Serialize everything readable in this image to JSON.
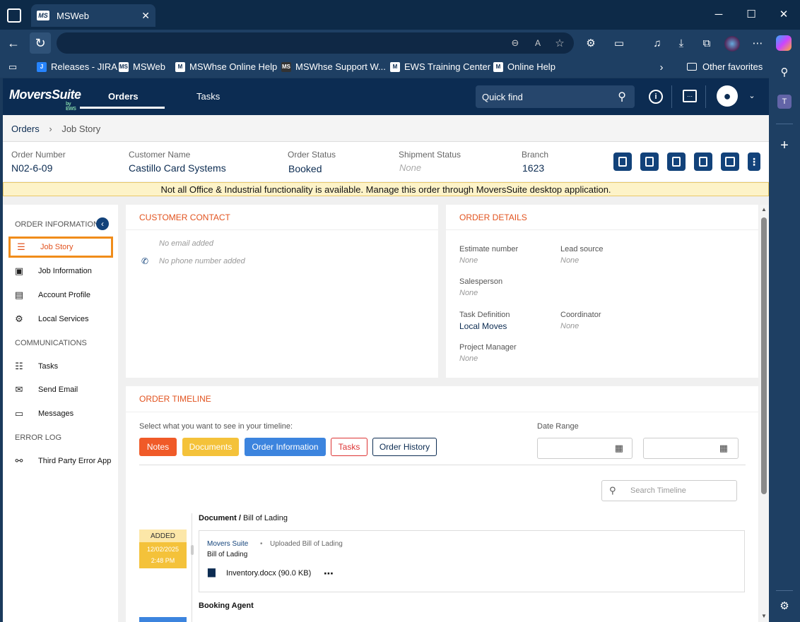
{
  "browser": {
    "tab_title": "MSWeb",
    "tab_favicon": "MS",
    "bookmarks": [
      {
        "label": "Releases - JIRA",
        "icon": "jira-icon"
      },
      {
        "label": "MSWeb",
        "icon": "MS"
      },
      {
        "label": "MSWhse Online Help",
        "icon": "M"
      },
      {
        "label": "MSWhse Support W...",
        "icon": "MS"
      },
      {
        "label": "EWS Training Center",
        "icon": "M"
      },
      {
        "label": "Online Help",
        "icon": "M"
      }
    ],
    "other_favorites": "Other favorites"
  },
  "app": {
    "logo": "MoversSuite",
    "logo_sub": "by EWS",
    "nav": {
      "orders": "Orders",
      "tasks": "Tasks"
    },
    "quick_find": "Quick find"
  },
  "breadcrumb": {
    "root": "Orders",
    "current": "Job Story"
  },
  "order": {
    "number_label": "Order Number",
    "number": "N02-6-09",
    "customer_label": "Customer Name",
    "customer": "Castillo Card Systems",
    "status_label": "Order Status",
    "status": "Booked",
    "shipment_label": "Shipment Status",
    "shipment": "None",
    "branch_label": "Branch",
    "branch": "1623"
  },
  "warning": "Not all Office & Industrial functionality is available. Manage this order through MoversSuite desktop application.",
  "sidebar": {
    "sec_order": "ORDER INFORMATION",
    "job_story": "Job Story",
    "job_information": "Job Information",
    "account_profile": "Account Profile",
    "local_services": "Local Services",
    "sec_comm": "COMMUNICATIONS",
    "tasks": "Tasks",
    "send_email": "Send Email",
    "messages": "Messages",
    "sec_error": "ERROR LOG",
    "third_party": "Third Party Error App"
  },
  "customer_contact": {
    "title": "CUSTOMER CONTACT",
    "email": "No email added",
    "phone": "No phone number added"
  },
  "order_details": {
    "title": "ORDER DETAILS",
    "estimate_label": "Estimate number",
    "estimate": "None",
    "lead_label": "Lead source",
    "lead": "None",
    "salesperson_label": "Salesperson",
    "salesperson": "None",
    "task_def_label": "Task Definition",
    "task_def": "Local Moves",
    "coordinator_label": "Coordinator",
    "coordinator": "None",
    "pm_label": "Project Manager",
    "pm": "None"
  },
  "timeline": {
    "title": "ORDER TIMELINE",
    "prompt": "Select what you want to see in your timeline:",
    "date_range": "Date Range",
    "filters": {
      "notes": "Notes",
      "documents": "Documents",
      "order_info": "Order Information",
      "tasks": "Tasks",
      "history": "Order History"
    },
    "search_placeholder": "Search Timeline",
    "entry1": {
      "type": "Document /",
      "subtype": "Bill of Lading",
      "badge": "ADDED",
      "date": "12/02/2025",
      "time": "2:48 PM",
      "author": "Movers Suite",
      "action": "Uploaded Bill of Lading",
      "doc_type": "Bill of Lading",
      "file": "Inventory.docx (90.0 KB)"
    },
    "entry2_title": "Booking Agent"
  }
}
